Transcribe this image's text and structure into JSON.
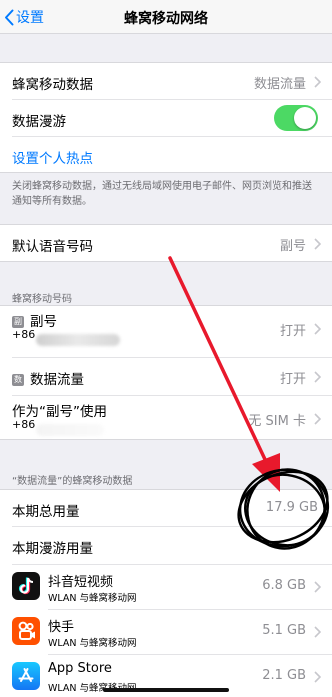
{
  "nav": {
    "back_label": "设置",
    "title": "蜂窝移动网络"
  },
  "main_group": {
    "cellular_data": {
      "label": "蜂窝移动数据",
      "value": "数据流量"
    },
    "data_roaming": {
      "label": "数据漫游",
      "toggle_on": true
    },
    "personal_hotspot": {
      "label": "设置个人热点"
    }
  },
  "note_text": "关闭蜂窝移动数据，通过无线局域网使用电子邮件、网页浏览和推送通知等所有数据。",
  "voice_group": {
    "label": "默认语音号码",
    "value": "副号"
  },
  "plans_header": "蜂窝移动号码",
  "plans": [
    {
      "badge": "副",
      "label": "副号",
      "sub": "+86",
      "value": "打开"
    },
    {
      "badge": "数",
      "label": "数据流量",
      "value": "打开"
    },
    {
      "label": "作为“副号”使用",
      "sub": "+86",
      "value": "无 SIM 卡"
    }
  ],
  "usage_header": "“数据流量”的蜂窝移动数据",
  "usage": {
    "current_period": {
      "label": "本期总用量",
      "value": "17.9 GB"
    },
    "roaming": {
      "label": "本期漫游用量"
    }
  },
  "apps": [
    {
      "name": "抖音短视频",
      "sub": "WLAN 与蜂窝移动网",
      "value": "6.8 GB",
      "icon": "douyin-icon"
    },
    {
      "name": "快手",
      "sub": "WLAN 与蜂窝移动网",
      "value": "5.1 GB",
      "icon": "kuaishou-icon"
    },
    {
      "name": "App Store",
      "sub": "WLAN 与蜂窝移动网",
      "value": "2.1 GB",
      "icon": "app-store-icon"
    }
  ],
  "colors": {
    "accent": "#007aff",
    "toggle_on": "#4cd964",
    "annotation": "#e8192c"
  }
}
